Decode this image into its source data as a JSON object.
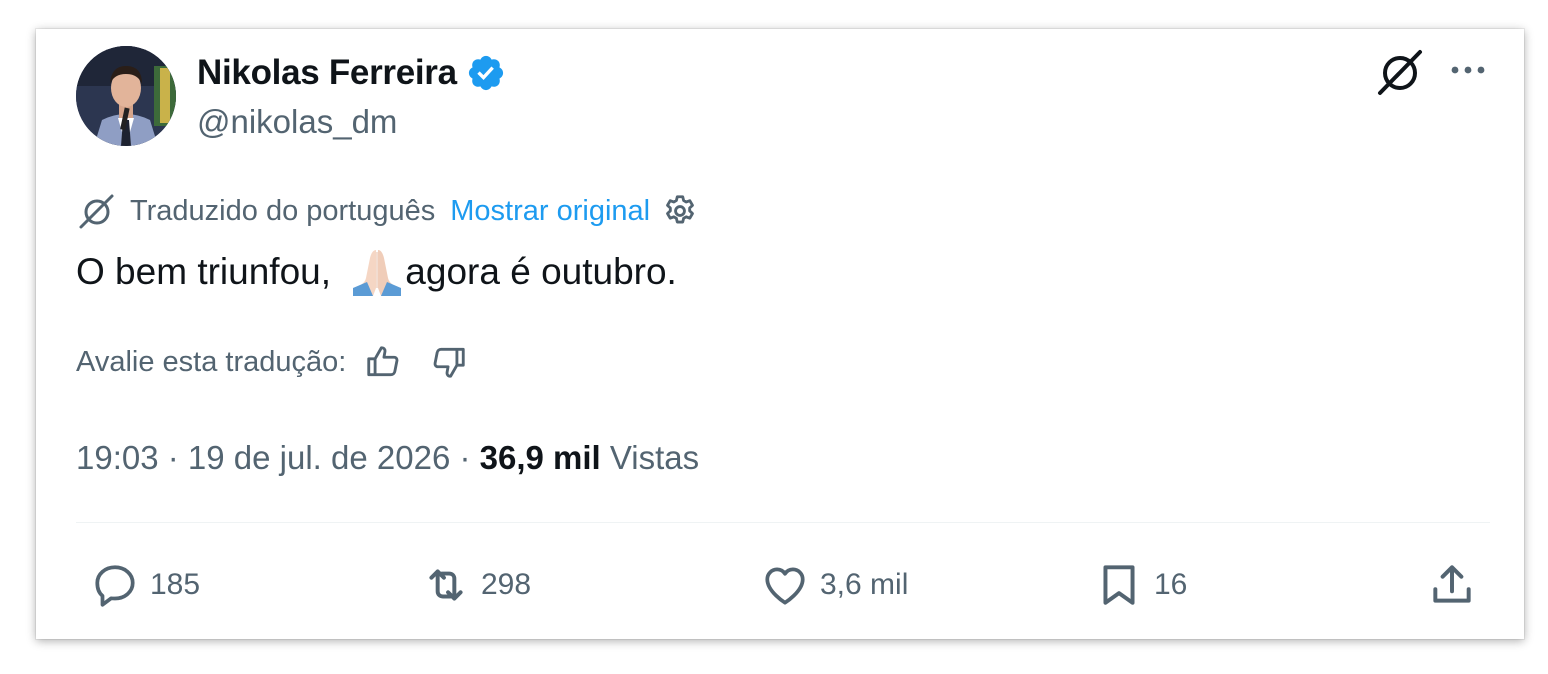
{
  "author": {
    "name": "Nikolas Ferreira",
    "handle": "@nikolas_dm",
    "verified": true
  },
  "icons": {
    "verified": "verified-badge-icon",
    "grok": "grok-icon",
    "more": "more-options-icon",
    "translate": "translate-icon",
    "settings": "gear-icon",
    "thumbs_up": "thumbs-up-icon",
    "thumbs_down": "thumbs-down-icon",
    "reply": "reply-icon",
    "retweet": "retweet-icon",
    "like": "heart-icon",
    "bookmark": "bookmark-icon",
    "share": "share-icon"
  },
  "translation": {
    "label": "Traduzido do português",
    "show_original": "Mostrar original",
    "rate_label": "Avalie esta tradução:"
  },
  "tweet": {
    "text_before": "O bem triunfou, ",
    "emoji": "folded-hands-emoji",
    "text_after": "agora é outubro."
  },
  "meta": {
    "time": "19:03",
    "date": "19 de jul. de 2026",
    "views_count": "36,9 mil",
    "views_label": "Vistas"
  },
  "actions": {
    "replies": "185",
    "retweets": "298",
    "likes": "3,6 mil",
    "bookmarks": "16"
  },
  "colors": {
    "accent": "#1d9bf0",
    "text_primary": "#0f1419",
    "text_secondary": "#536471",
    "divider": "#eff3f4"
  }
}
